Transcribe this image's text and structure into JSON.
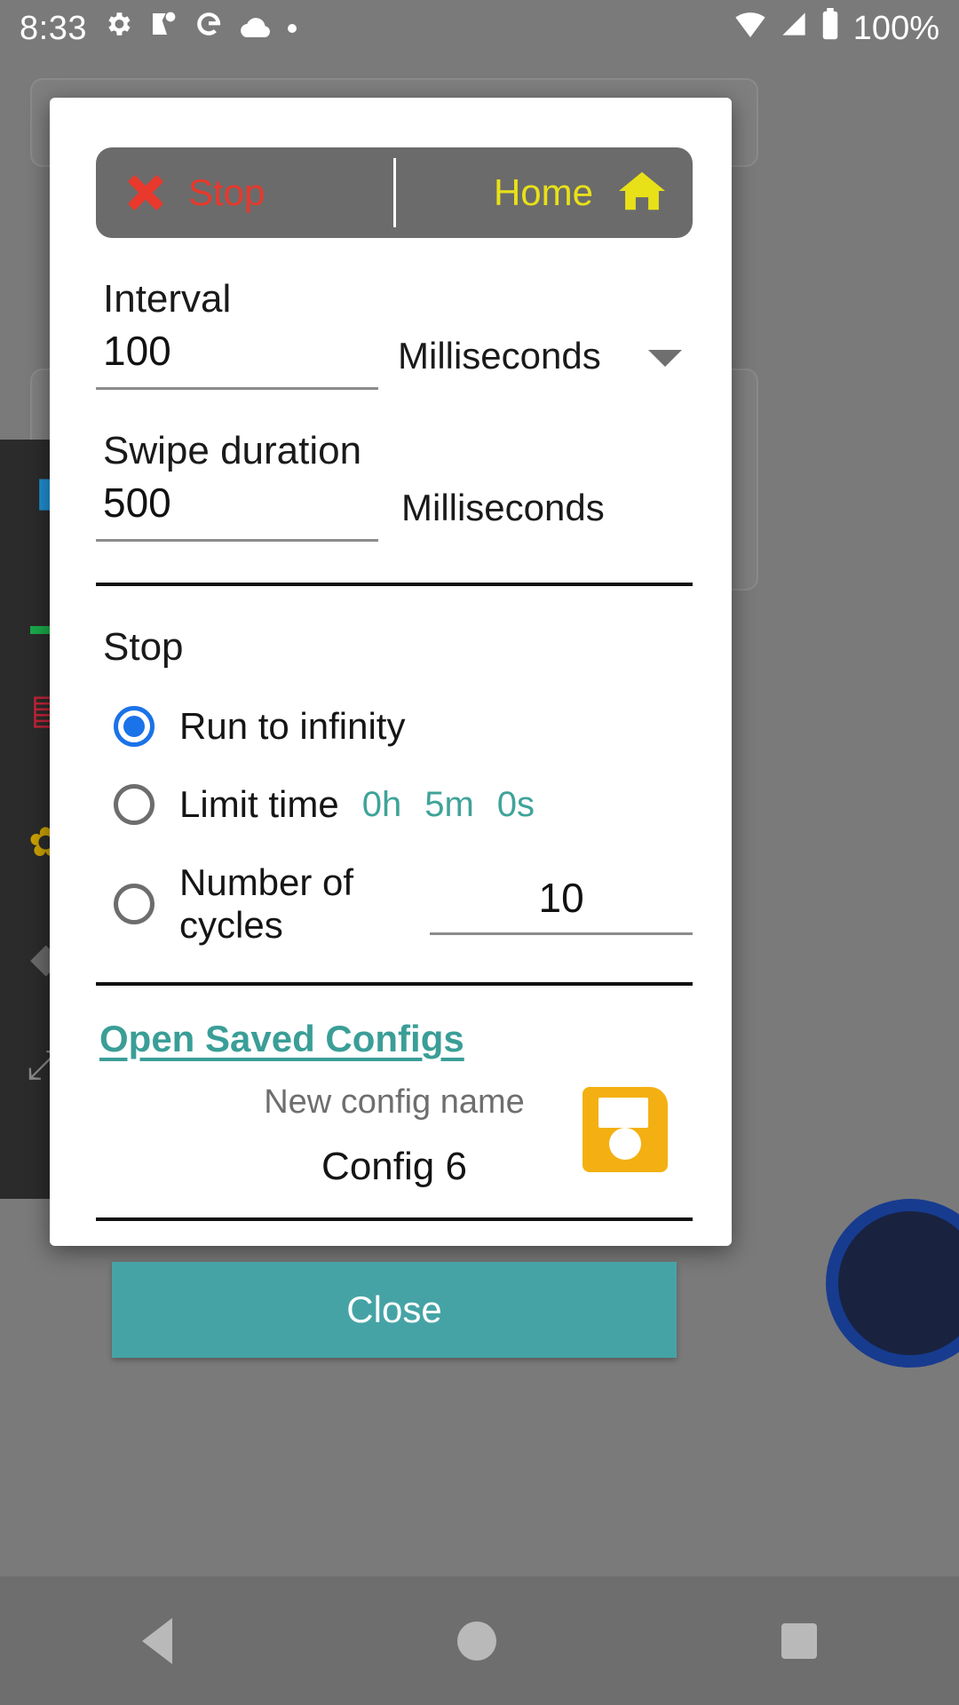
{
  "statusbar": {
    "time": "8:33",
    "icons": [
      "gear-icon",
      "maps-icon",
      "google-g-icon",
      "cloud-icon",
      "dot-icon"
    ],
    "wifi": "wifi-icon",
    "signal": "signal-icon",
    "battery": "battery-icon",
    "battery_percent": "100%"
  },
  "dialog": {
    "toolbar": {
      "stop_label": "Stop",
      "home_label": "Home",
      "stop_color": "#e8392c",
      "home_color": "#e8e118",
      "background": "#6b6b6b"
    },
    "interval": {
      "label": "Interval",
      "value": "100",
      "placeholder": "100",
      "unit": "Milliseconds"
    },
    "swipe_duration": {
      "label": "Swipe duration",
      "value": "500",
      "placeholder": "500",
      "unit": "Milliseconds"
    },
    "stop_section": {
      "label": "Stop",
      "options": [
        {
          "label": "Run to infinity",
          "selected": true
        },
        {
          "label": "Limit time",
          "selected": false
        },
        {
          "label": "Number of cycles",
          "selected": false
        }
      ],
      "limit_time": {
        "hours": "0h",
        "minutes": "5m",
        "seconds": "0s",
        "color": "#3fa39a"
      },
      "cycles_value": "10"
    },
    "configs": {
      "open_link": "Open Saved Configs",
      "link_color": "#3a9e97",
      "name_hint": "New config name",
      "name_value": "Config 6",
      "save_icon": "save-floppy-icon",
      "save_icon_color": "#f4b012"
    },
    "close_label": "Close",
    "close_color": "#46a3a5"
  },
  "navbar": {
    "back": "back-triangle-icon",
    "home": "home-circle-icon",
    "recents": "recents-square-icon"
  }
}
